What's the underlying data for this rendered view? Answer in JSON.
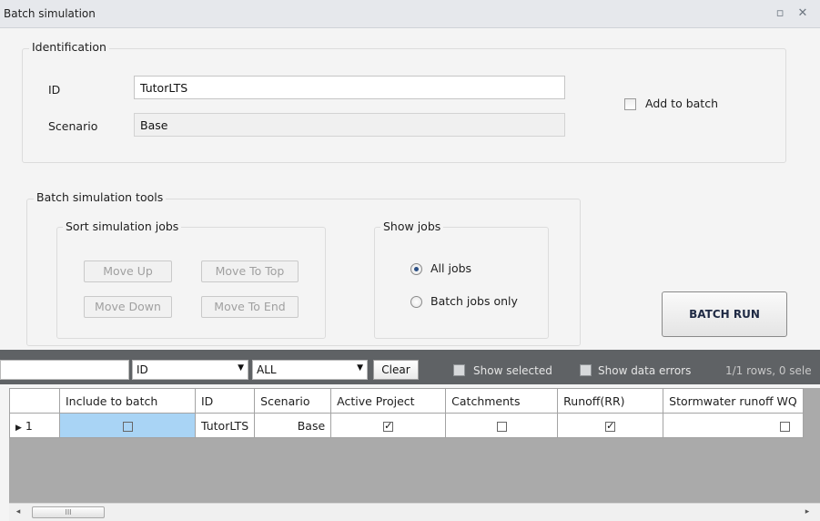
{
  "window": {
    "title": "Batch simulation"
  },
  "identification": {
    "legend": "Identification",
    "id_label": "ID",
    "id_value": "TutorLTS",
    "scenario_label": "Scenario",
    "scenario_value": "Base",
    "add_to_batch_label": "Add to batch"
  },
  "tools": {
    "legend": "Batch simulation tools",
    "sort": {
      "legend": "Sort simulation jobs",
      "move_up": "Move Up",
      "move_to_top": "Move To Top",
      "move_down": "Move Down",
      "move_to_end": "Move To End"
    },
    "show": {
      "legend": "Show jobs",
      "all_jobs": "All jobs",
      "batch_only": "Batch jobs only",
      "selected": "All jobs"
    },
    "batch_run": "BATCH RUN"
  },
  "filter": {
    "search_value": "",
    "column_select": "ID",
    "value_select": "ALL",
    "clear": "Clear",
    "show_selected": "Show selected",
    "show_data_errors": "Show data errors",
    "rows_info": "1/1 rows, 0 sele"
  },
  "grid": {
    "columns": [
      "Include to batch",
      "ID",
      "Scenario",
      "Active Project",
      "Catchments",
      "Runoff(RR)",
      "Stormwater runoff WQ"
    ],
    "rows": [
      {
        "num": "1",
        "id": "TutorLTS",
        "scenario": "Base",
        "include": false,
        "active_project": true,
        "catchments": false,
        "runoff": true,
        "stormwater": false
      }
    ]
  },
  "scrollbar": {
    "thumb": "III"
  }
}
